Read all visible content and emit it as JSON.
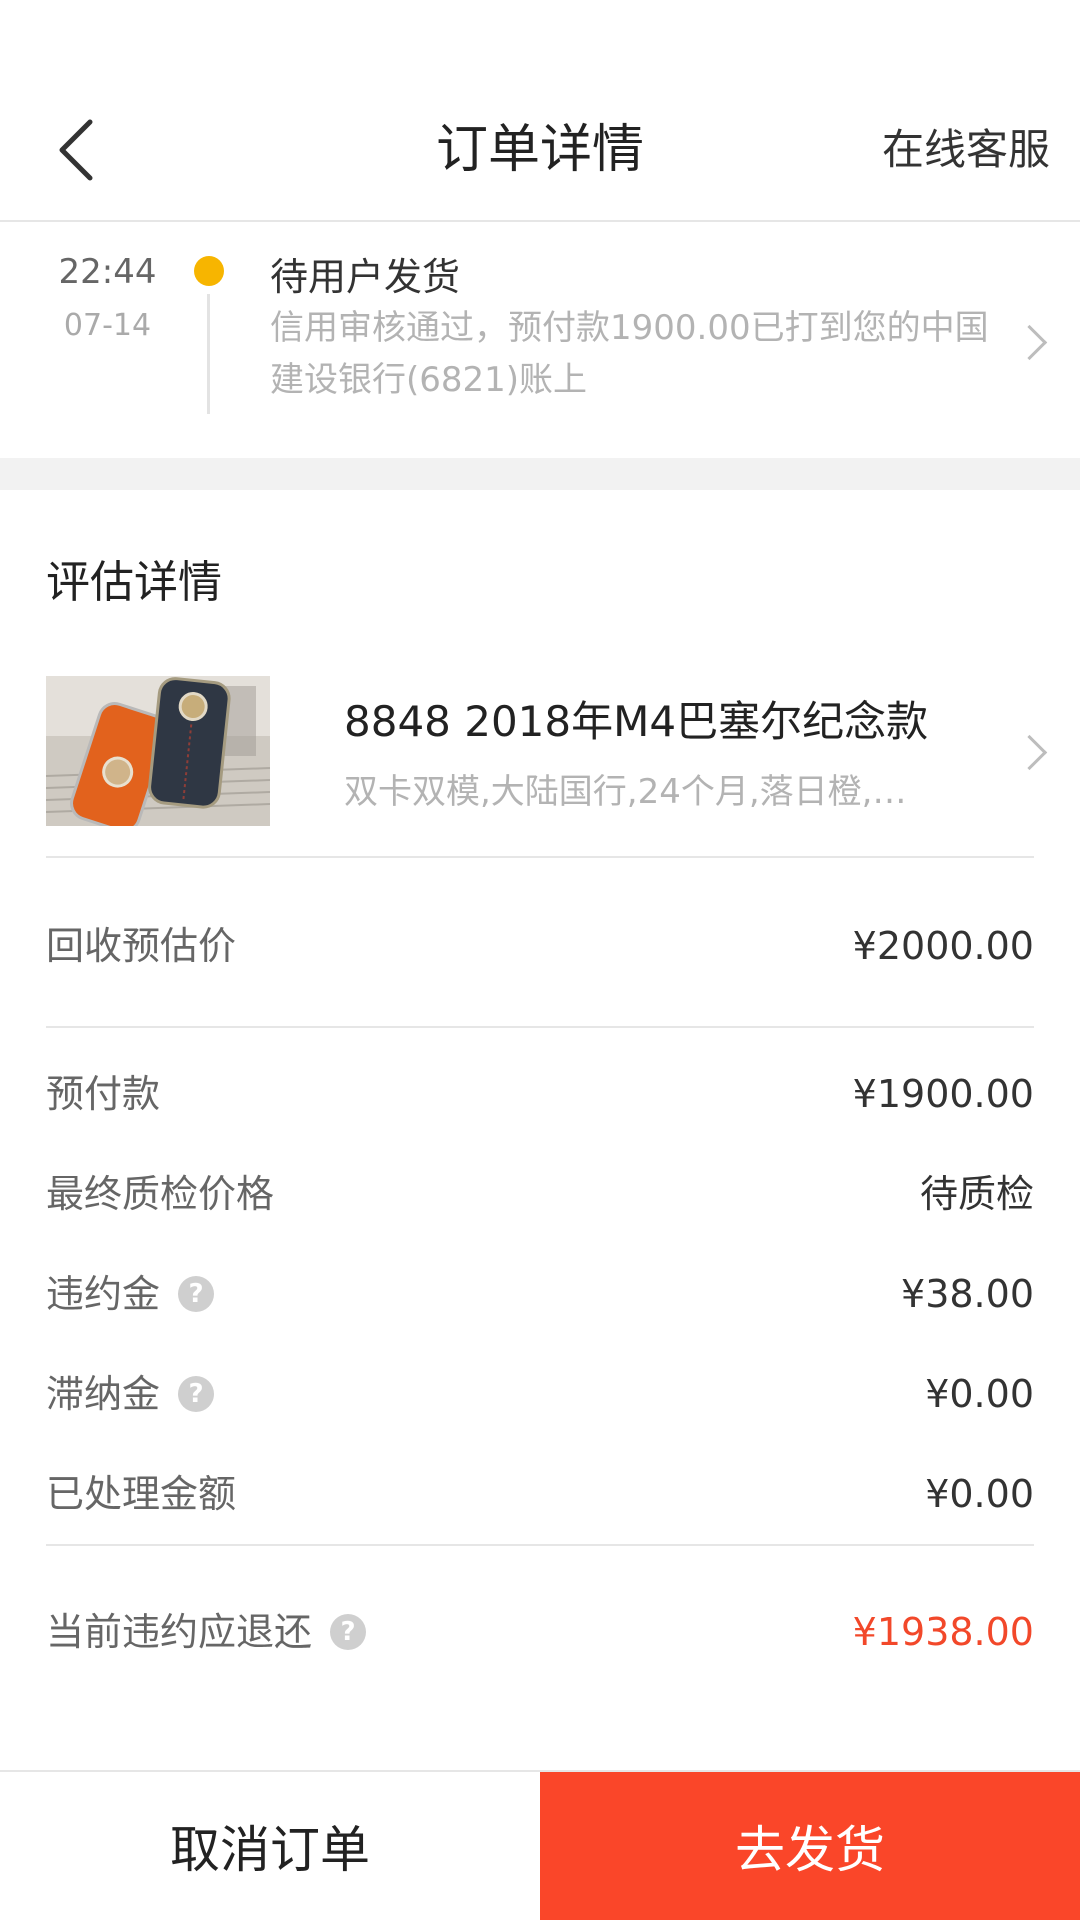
{
  "header": {
    "title": "订单详情",
    "customer_service": "在线客服"
  },
  "status": {
    "time": "22:44",
    "date": "07-14",
    "title": "待用户发货",
    "description": "信用审核通过，预付款1900.00已打到您的中国建设银行(6821)账上",
    "dot_color": "#f7b500"
  },
  "evaluation": {
    "section_title": "评估详情",
    "product_name": "8848 2018年M4巴塞尔纪念款",
    "product_spec": "双卡双模,大陆国行,24个月,落日橙,…"
  },
  "prices": {
    "estimate": {
      "label": "回收预估价",
      "value": "¥2000.00"
    },
    "prepaid": {
      "label": "预付款",
      "value": "¥1900.00"
    },
    "final_check": {
      "label": "最终质检价格",
      "value": "待质检"
    },
    "penalty": {
      "label": "违约金",
      "value": "¥38.00"
    },
    "late_fee": {
      "label": "滞纳金",
      "value": "¥0.00"
    },
    "processed": {
      "label": "已处理金额",
      "value": "¥0.00"
    },
    "refund": {
      "label": "当前违约应退还",
      "value": "¥1938.00"
    }
  },
  "help_glyph": "?",
  "actions": {
    "cancel": "取消订单",
    "ship": "去发货"
  },
  "colors": {
    "accent": "#fa4629",
    "refund_text": "#f2482a"
  }
}
